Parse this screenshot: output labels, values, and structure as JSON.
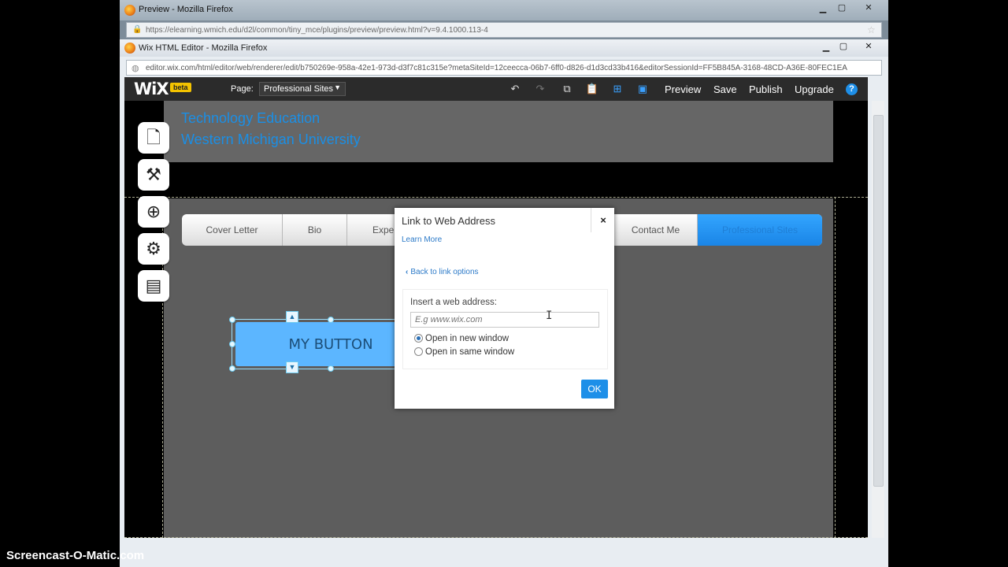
{
  "outer_window": {
    "title": "Preview - Mozilla Firefox",
    "url": "https://elearning.wmich.edu/d2l/common/tiny_mce/plugins/preview/preview.html?v=9.4.1000.113-4"
  },
  "inner_window": {
    "title": "Wix HTML Editor - Mozilla Firefox",
    "url": "editor.wix.com/html/editor/web/renderer/edit/b750269e-958a-42e1-973d-d3f7c81c315e?metaSiteId=12ceecca-06b7-6ff0-d826-d1d3cd33b416&editorSessionId=FF5B845A-3168-48CD-A36E-80FEC1EA"
  },
  "wix_topbar": {
    "logo": "WiX",
    "beta": "beta",
    "page_label": "Page:",
    "page_value": "Professional Sites",
    "preview": "Preview",
    "save": "Save",
    "publish": "Publish",
    "upgrade": "Upgrade",
    "help": "?"
  },
  "header": {
    "line1": "Technology Education",
    "line2": "Western Michigan University"
  },
  "menu": {
    "items": [
      "Cover Letter",
      "Bio",
      "Expe",
      "Contact Me",
      "Professional Sites"
    ]
  },
  "canvas_button": {
    "label": "MY BUTTON"
  },
  "dialog": {
    "title": "Link to Web Address",
    "close": "×",
    "learn_more": "Learn More",
    "back": "Back to link options",
    "address_label": "Insert a web address:",
    "address_placeholder": "E.g www.wix.com",
    "address_value": "",
    "options": [
      {
        "label": "Open in new window",
        "checked": true
      },
      {
        "label": "Open in same window",
        "checked": false
      }
    ],
    "ok": "OK"
  },
  "watermark": "Screencast-O-Matic.com",
  "colors": {
    "accent": "#1e8fe8",
    "button_fill": "#5cb6ff",
    "header_text": "#1a8fe6"
  }
}
